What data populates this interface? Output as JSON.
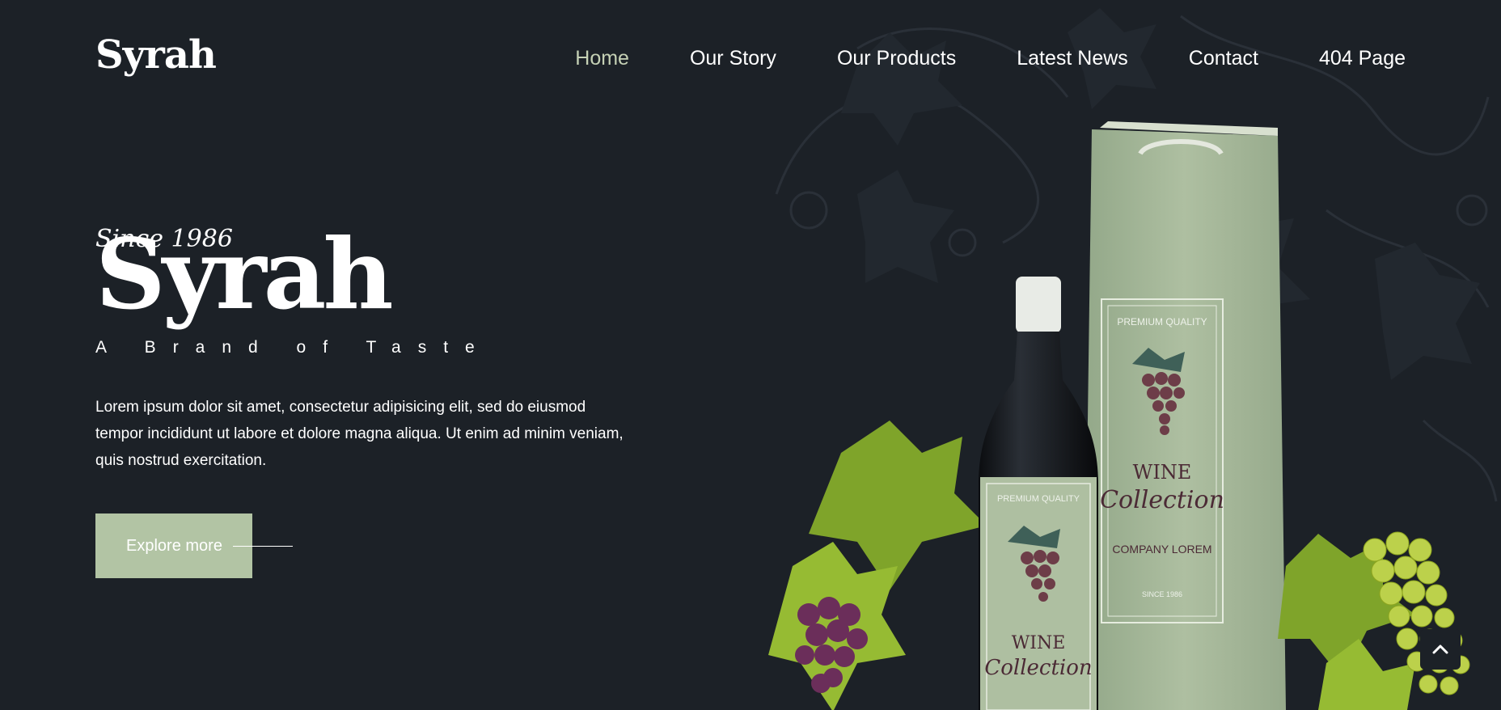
{
  "header": {
    "logo": "Syrah",
    "nav": [
      {
        "label": "Home",
        "active": true
      },
      {
        "label": "Our Story",
        "active": false
      },
      {
        "label": "Our Products",
        "active": false
      },
      {
        "label": "Latest News",
        "active": false
      },
      {
        "label": "Contact",
        "active": false
      },
      {
        "label": "404 Page",
        "active": false
      }
    ]
  },
  "hero": {
    "since": "Since 1986",
    "brand": "Syrah",
    "tagline": "A Brand of Taste",
    "description": "Lorem ipsum dolor sit amet, consectetur adipisicing elit, sed do eiusmod tempor incididunt ut labore et dolore magna aliqua. Ut enim ad minim veniam, quis nostrud exercitation.",
    "cta_label": "Explore more"
  },
  "product": {
    "label_top": "PREMIUM QUALITY",
    "label_title": "WINE",
    "label_script": "Collection",
    "label_company": "COMPANY LOREM",
    "label_since": "SINCE 1986"
  },
  "icons": {
    "scroll_top": "chevron-up-icon"
  },
  "colors": {
    "background": "#1c2127",
    "accent": "#b2c4a4",
    "nav_active": "#c5d1b5",
    "text": "#ffffff"
  }
}
